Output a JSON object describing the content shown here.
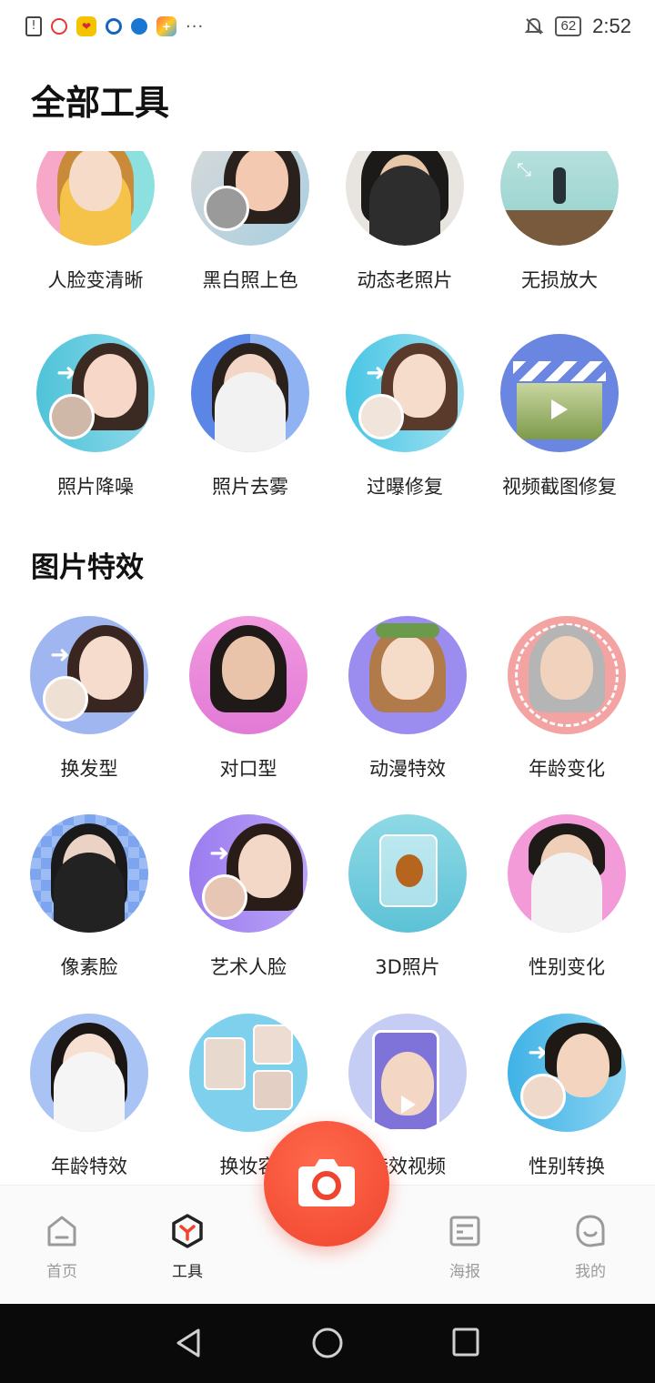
{
  "status_bar": {
    "battery": "62",
    "time": "2:52",
    "more": "···"
  },
  "sections": {
    "all_tools_title": "全部工具",
    "effects_title": "图片特效"
  },
  "all_tools": [
    {
      "label": "人脸变清晰"
    },
    {
      "label": "黑白照上色"
    },
    {
      "label": "动态老照片"
    },
    {
      "label": "无损放大"
    },
    {
      "label": "照片降噪"
    },
    {
      "label": "照片去雾"
    },
    {
      "label": "过曝修复"
    },
    {
      "label": "视频截图修复"
    }
  ],
  "effects": [
    {
      "label": "换发型"
    },
    {
      "label": "对口型"
    },
    {
      "label": "动漫特效"
    },
    {
      "label": "年龄变化"
    },
    {
      "label": "像素脸"
    },
    {
      "label": "艺术人脸"
    },
    {
      "label": "3D照片"
    },
    {
      "label": "性别变化"
    },
    {
      "label": "年龄特效"
    },
    {
      "label": "换妆容"
    },
    {
      "label": "特效视频"
    },
    {
      "label": "性别转换"
    }
  ],
  "bottom_nav": {
    "home": "首页",
    "tools": "工具",
    "poster": "海报",
    "mine": "我的"
  },
  "colors": {
    "accent": "#f0442e",
    "nav_inactive": "#9a9a9a"
  }
}
